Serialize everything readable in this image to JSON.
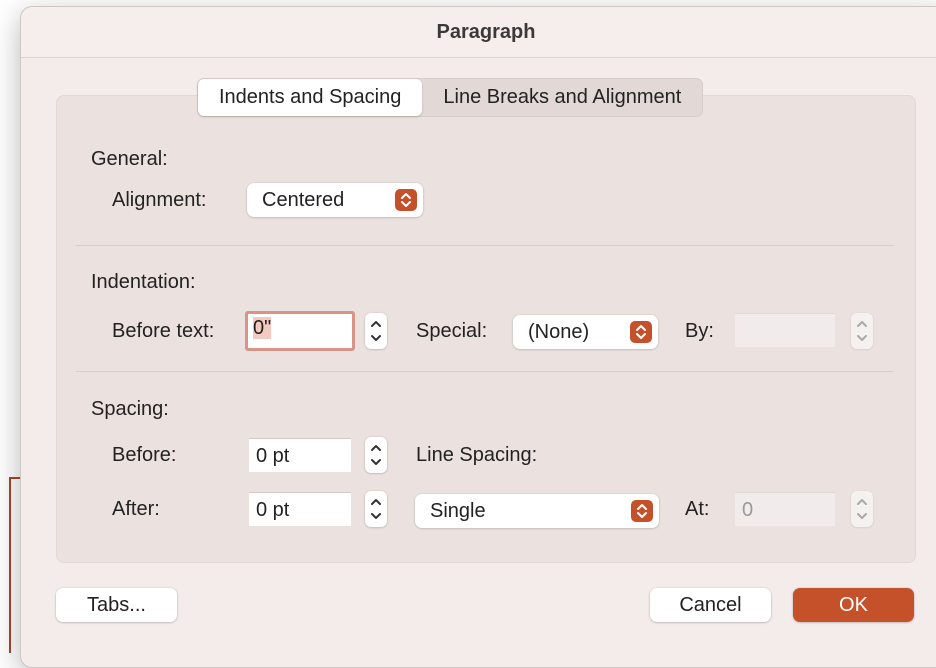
{
  "window": {
    "title": "Paragraph"
  },
  "tabs": [
    {
      "label": "Indents and Spacing",
      "active": true
    },
    {
      "label": "Line Breaks and Alignment",
      "active": false
    }
  ],
  "general": {
    "heading": "General:",
    "alignment_label": "Alignment:",
    "alignment_value": "Centered"
  },
  "indentation": {
    "heading": "Indentation:",
    "before_text_label": "Before text:",
    "before_text_value": "0\"",
    "special_label": "Special:",
    "special_value": "(None)",
    "by_label": "By:",
    "by_value": ""
  },
  "spacing": {
    "heading": "Spacing:",
    "before_label": "Before:",
    "before_value": "0 pt",
    "after_label": "After:",
    "after_value": "0 pt",
    "line_spacing_label": "Line Spacing:",
    "line_spacing_value": "Single",
    "at_label": "At:",
    "at_value": "0"
  },
  "buttons": {
    "tabs": "Tabs...",
    "cancel": "Cancel",
    "ok": "OK"
  },
  "colors": {
    "accent": "#c4512a",
    "dialog_bg": "#f4ecea",
    "annotation": "#b5412a"
  }
}
